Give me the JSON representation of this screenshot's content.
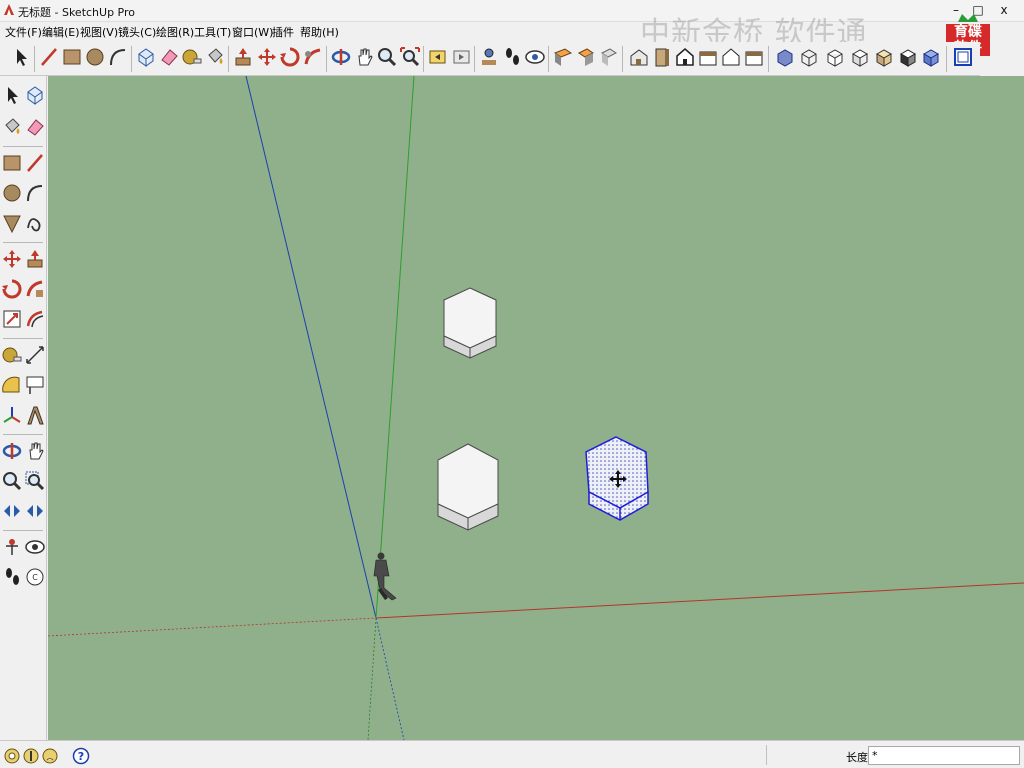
{
  "window": {
    "title": "无标题 - SketchUp Pro",
    "min_label": "–",
    "max_label": "□",
    "close_label": "x"
  },
  "menu": [
    {
      "label": "文件(F)"
    },
    {
      "label": "编辑(E)"
    },
    {
      "label": "视图(V)"
    },
    {
      "label": "镜头(C)"
    },
    {
      "label": "绘图(R)"
    },
    {
      "label": "工具(T)"
    },
    {
      "label": "窗口(W)"
    },
    {
      "label": "插件"
    },
    {
      "label": "帮助(H)"
    }
  ],
  "watermark": {
    "text": "中新金桥 软件通"
  },
  "logo": {
    "line1": "育碟",
    "line2": "软件"
  },
  "top_toolbar": {
    "tools": [
      "select-icon",
      "line-icon",
      "rectangle-icon",
      "circle-icon",
      "arc-icon",
      "make-component-icon",
      "eraser-icon",
      "tape-measure-icon",
      "paint-bucket-icon",
      "push-pull-icon",
      "move-icon",
      "rotate-icon",
      "follow-me-icon",
      "orbit-icon",
      "pan-icon",
      "zoom-icon",
      "zoom-extents-icon",
      "previous-view-icon",
      "next-view-icon",
      "position-camera-icon",
      "walk-icon",
      "look-around-icon",
      "section-plane-icon",
      "display-section-icon",
      "section-cuts-icon",
      "iso-view-icon",
      "top-view-icon",
      "front-view-icon",
      "right-view-icon",
      "back-view-icon",
      "left-view-icon",
      "xray-icon",
      "wireframe-icon",
      "hidden-line-icon",
      "shaded-icon",
      "shaded-texture-icon",
      "monochrome-icon",
      "component-browser-icon"
    ]
  },
  "left_toolbar": {
    "tools": [
      "select-icon",
      "make-component-icon",
      "paint-bucket-icon",
      "eraser-icon",
      "rectangle-icon",
      "line-icon",
      "circle-icon",
      "arc-icon",
      "polygon-icon",
      "freehand-icon",
      "move-icon",
      "push-pull-icon",
      "rotate-icon",
      "follow-me-icon",
      "scale-icon",
      "offset-icon",
      "tape-measure-icon",
      "dimension-icon",
      "protractor-icon",
      "text-icon",
      "axes-icon",
      "3d-text-icon",
      "orbit-icon",
      "pan-icon",
      "zoom-icon",
      "zoom-window-icon",
      "zoom-extents-icon",
      "previous-view-icon",
      "position-camera-icon",
      "look-around-icon",
      "walk-icon",
      "section-plane-icon"
    ]
  },
  "viewport": {
    "background_color": "#8fb08b",
    "axis_colors": {
      "red": "#b5342a",
      "green": "#2e9e2e",
      "blue": "#1b3fb0"
    },
    "selection_color": "#1e1ed8",
    "objects": [
      {
        "name": "hexagonal-prism-top",
        "selected": false
      },
      {
        "name": "hexagonal-prism-bottom-left",
        "selected": false
      },
      {
        "name": "hexagonal-prism-selected",
        "selected": true
      }
    ]
  },
  "status": {
    "icons": [
      "geo-location-icon",
      "credits-icon",
      "user-icon",
      "help-icon"
    ],
    "length_label": "长度",
    "length_value": "*"
  }
}
